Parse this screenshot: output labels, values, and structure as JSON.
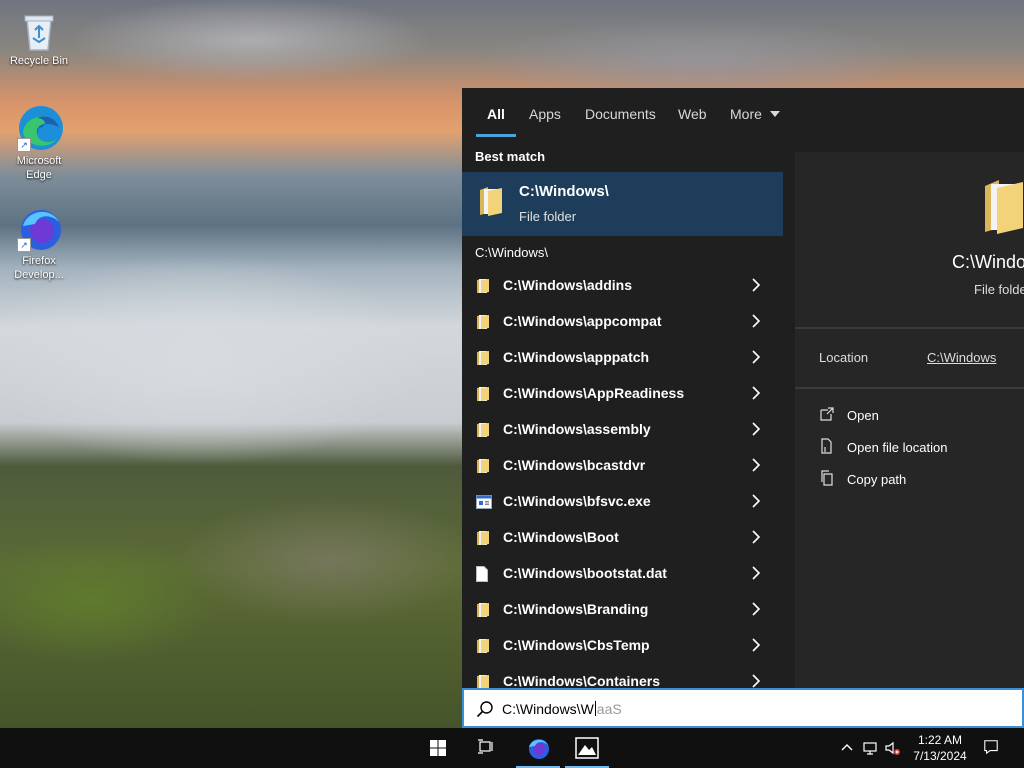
{
  "desktop": {
    "icons": [
      {
        "label": "Recycle Bin"
      },
      {
        "label": "Microsoft Edge"
      },
      {
        "label": "Firefox Develop..."
      }
    ]
  },
  "search": {
    "tabs": [
      "All",
      "Apps",
      "Documents",
      "Web",
      "More"
    ],
    "active_tab": "All",
    "best_match_heading": "Best match",
    "best_match": {
      "title": "C:\\Windows\\",
      "subtitle": "File folder"
    },
    "folder_heading": "C:\\Windows\\",
    "results": [
      {
        "label": "C:\\Windows\\addins",
        "icon": "folder-icon"
      },
      {
        "label": "C:\\Windows\\appcompat",
        "icon": "folder-icon"
      },
      {
        "label": "C:\\Windows\\apppatch",
        "icon": "folder-icon"
      },
      {
        "label": "C:\\Windows\\AppReadiness",
        "icon": "folder-icon"
      },
      {
        "label": "C:\\Windows\\assembly",
        "icon": "folder-icon"
      },
      {
        "label": "C:\\Windows\\bcastdvr",
        "icon": "folder-icon"
      },
      {
        "label": "C:\\Windows\\bfsvc.exe",
        "icon": "app-icon"
      },
      {
        "label": "C:\\Windows\\Boot",
        "icon": "folder-icon"
      },
      {
        "label": "C:\\Windows\\bootstat.dat",
        "icon": "file-icon"
      },
      {
        "label": "C:\\Windows\\Branding",
        "icon": "folder-icon"
      },
      {
        "label": "C:\\Windows\\CbsTemp",
        "icon": "folder-icon"
      },
      {
        "label": "C:\\Windows\\Containers",
        "icon": "folder-icon"
      }
    ],
    "preview": {
      "title": "C:\\Windo",
      "subtitle": "File folde",
      "location_label": "Location",
      "location_value": "C:\\Windows",
      "actions": [
        {
          "label": "Open",
          "icon": "open-icon"
        },
        {
          "label": "Open file location",
          "icon": "file-location-icon"
        },
        {
          "label": "Copy path",
          "icon": "copy-icon"
        }
      ]
    },
    "query_typed": "C:\\Windows\\W",
    "query_suggestion": "aaS"
  },
  "taskbar": {
    "clock_time": "1:22 AM",
    "clock_date": "7/13/2024"
  },
  "colors": {
    "accent": "#4aa3df",
    "best_match_bg": "#1d3d5a",
    "panel_bg": "#1f1f1f"
  }
}
